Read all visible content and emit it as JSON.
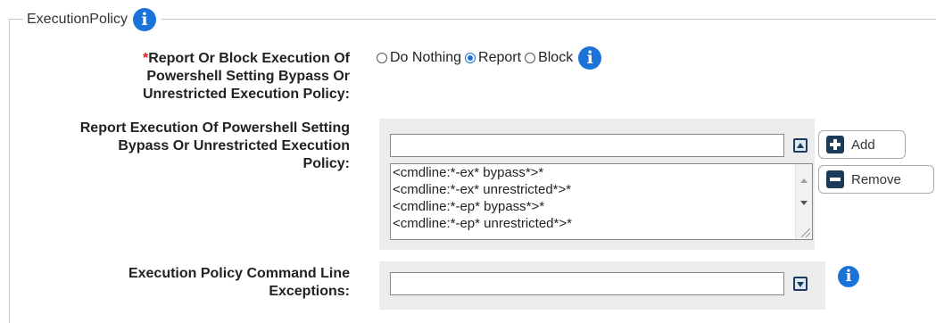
{
  "section": {
    "title": "ExecutionPolicy"
  },
  "report_or_block": {
    "required_marker": "*",
    "label_lines": [
      "Report Or Block Execution Of",
      "Powershell Setting Bypass Or",
      "Unrestricted Execution Policy:"
    ],
    "options": [
      {
        "label": "Do Nothing",
        "checked": false
      },
      {
        "label": "Report",
        "checked": true
      },
      {
        "label": "Block",
        "checked": false
      }
    ]
  },
  "report_execution": {
    "label_lines": [
      "Report Execution Of Powershell Setting",
      "Bypass Or Unrestricted Execution",
      "Policy:"
    ],
    "input_value": "",
    "items": [
      "<cmdline:*-ex* bypass*>*",
      "<cmdline:*-ex* unrestricted*>*",
      "<cmdline:*-ep* bypass*>*",
      "<cmdline:*-ep* unrestricted*>*"
    ],
    "add_label": "Add",
    "remove_label": "Remove"
  },
  "exceptions": {
    "label_lines": [
      "Execution Policy Command Line",
      "Exceptions:"
    ],
    "input_value": ""
  },
  "icons": {
    "info": "info-icon",
    "add": "plus-square-icon",
    "remove": "minus-square-icon",
    "move_up": "arrow-up-icon",
    "expand": "arrow-down-icon"
  },
  "colors": {
    "accent": "#1a73d9",
    "required": "#dd2222",
    "panel_bg": "#ececec",
    "button_icon": "#1c3b5a"
  }
}
